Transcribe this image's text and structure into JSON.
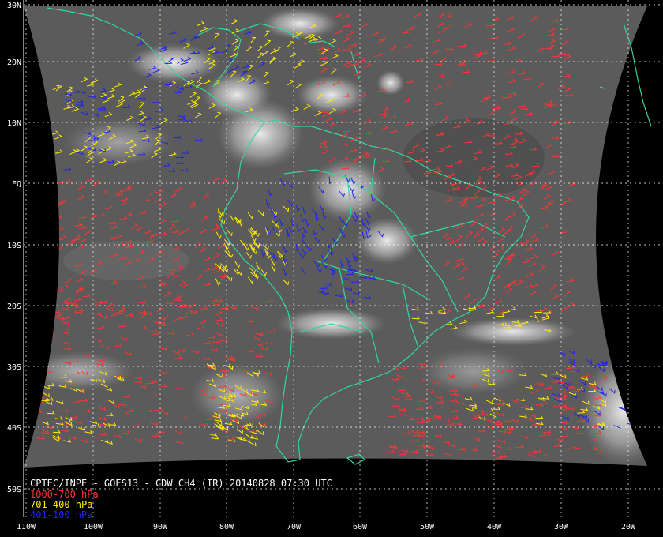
{
  "title": "CPTEC/INPE - GOES13 - CDW CH4 (IR) 20140828 07:30 UTC",
  "legend": [
    {
      "label": "1000-700 hPa",
      "color": "#ff3333"
    },
    {
      "label": "701-400 hPa",
      "color": "#ffee00"
    },
    {
      "label": "401-100 hPa",
      "color": "#2222ee"
    }
  ],
  "lat_labels": [
    "30N",
    "20N",
    "10N",
    "EQ",
    "10S",
    "20S",
    "30S",
    "40S",
    "50S"
  ],
  "lon_labels": [
    "110W",
    "100W",
    "90W",
    "80W",
    "70W",
    "60W",
    "50W",
    "40W",
    "30W",
    "20W"
  ],
  "colors": {
    "coastline": "#33d6a0",
    "background": "#000000",
    "grid": "#ffffff"
  },
  "map_extent": {
    "lon": [
      -110,
      -16
    ],
    "lat": [
      -54,
      30
    ]
  }
}
